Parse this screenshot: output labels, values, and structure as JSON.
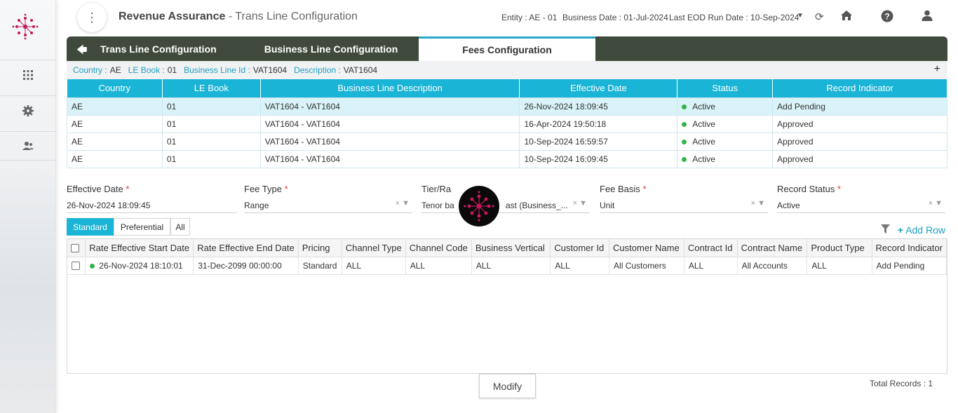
{
  "header": {
    "app_name": "Revenue Assurance",
    "page_name": " - Trans Line Configuration",
    "entity": "Entity : AE - 01",
    "business_date": "Business Date : 01-Jul-2024",
    "last_eod": "Last EOD Run Date : 10-Sep-2024"
  },
  "tabs": [
    {
      "label": "Trans Line Configuration"
    },
    {
      "label": "Business Line Configuration"
    },
    {
      "label": "Fees Configuration"
    }
  ],
  "info": {
    "country_k": "Country :",
    "country_v": "AE",
    "lebook_k": "LE Book :",
    "lebook_v": "01",
    "blid_k": "Business Line Id :",
    "blid_v": "VAT1604",
    "desc_k": "Description :",
    "desc_v": "VAT1604"
  },
  "grid1": {
    "headers": [
      "Country",
      "LE Book",
      "Business Line Description",
      "Effective Date",
      "Status",
      "Record Indicator"
    ],
    "rows": [
      [
        "AE",
        "01",
        "VAT1604 - VAT1604",
        "26-Nov-2024 18:09:45",
        "Active",
        "Add Pending"
      ],
      [
        "AE",
        "01",
        "VAT1604 - VAT1604",
        "16-Apr-2024 19:50:18",
        "Active",
        "Approved"
      ],
      [
        "AE",
        "01",
        "VAT1604 - VAT1604",
        "10-Sep-2024 16:59:57",
        "Active",
        "Approved"
      ],
      [
        "AE",
        "01",
        "VAT1604 - VAT1604",
        "10-Sep-2024 16:09:45",
        "Active",
        "Approved"
      ]
    ],
    "status_color": "#36b24a"
  },
  "form": {
    "effective_date": {
      "label": "Effective Date",
      "value": "26-Nov-2024 18:09:45"
    },
    "fee_type": {
      "label": "Fee Type",
      "value": "Range"
    },
    "tier_range": {
      "label": "Tier/Ra",
      "value": "Tenor ba",
      "value2": "ast (Business_..."
    },
    "fee_basis": {
      "label": "Fee Basis",
      "value": "Unit"
    },
    "record_status": {
      "label": "Record Status",
      "value": "Active"
    }
  },
  "toggles": [
    "Standard",
    "Preferential",
    "All"
  ],
  "add_row": "Add Row",
  "grid2": {
    "headers": [
      "Rate Effective Start Date",
      "Rate Effective End Date",
      "Pricing",
      "Channel Type",
      "Channel Code",
      "Business Vertical",
      "Customer Id",
      "Customer Name",
      "Contract Id",
      "Contract Name",
      "Product Type",
      "Record Indicator"
    ],
    "rows": [
      [
        "26-Nov-2024 18:10:01",
        "31-Dec-2099 00:00:00",
        "Standard",
        "ALL",
        "ALL",
        "ALL",
        "ALL",
        "All Customers",
        "ALL",
        "All Accounts",
        "ALL",
        "Add Pending"
      ]
    ]
  },
  "modify_label": "Modify",
  "total_records": "Total Records  :  1",
  "colors": {
    "accent": "#1ab4d6",
    "tabbar": "#3f4a3c",
    "brand": "#c2185b"
  }
}
